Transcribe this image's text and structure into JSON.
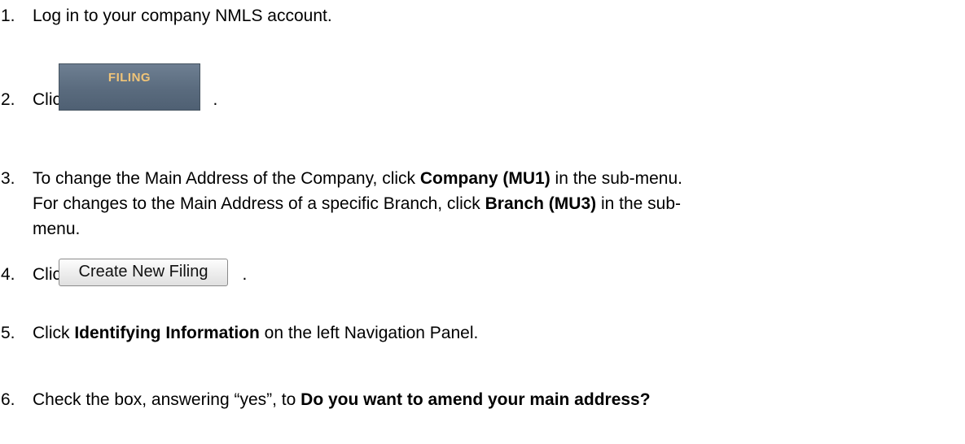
{
  "steps": [
    {
      "number": "1.",
      "text": "Log in to your company NMLS account."
    },
    {
      "number": "2.",
      "prefix": "Click",
      "suffix": ".",
      "button_label": "FILING"
    },
    {
      "number": "3.",
      "line1_a": "To change the Main Address of the Company, click ",
      "line1_bold": "Company (MU1)",
      "line1_b": " in the sub-menu.",
      "line2_a": "For changes to the Main Address of a specific Branch, click ",
      "line2_bold": "Branch (MU3)",
      "line2_b": " in the sub-",
      "line3": "menu."
    },
    {
      "number": "4.",
      "prefix": "Click",
      "suffix": ".",
      "button_label": "Create New Filing"
    },
    {
      "number": "5.",
      "a": "Click ",
      "bold": "Identifying Information",
      "b": " on the left Navigation Panel."
    },
    {
      "number": "6.",
      "a": "Check the box, answering “yes”, to ",
      "bold": "Do you want to amend your main address?"
    }
  ]
}
